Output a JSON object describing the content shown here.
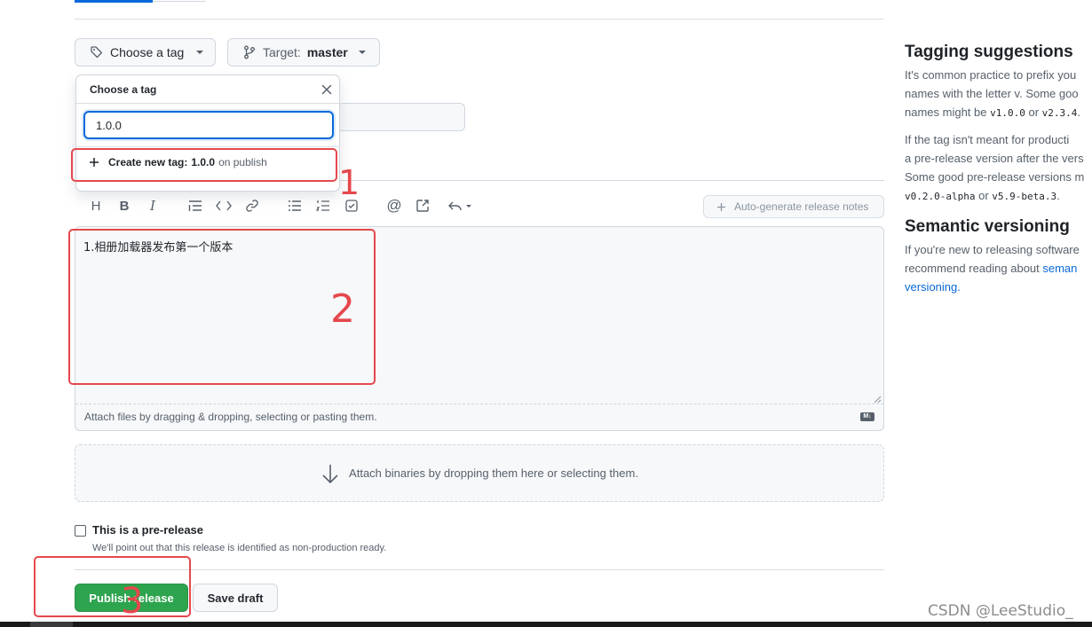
{
  "tag_button": {
    "label": "Choose a tag"
  },
  "target_button": {
    "prefix": "Target:",
    "branch": "master"
  },
  "tag_dropdown": {
    "title": "Choose a tag",
    "input_value": "1.0.0",
    "create_prefix": "Create new tag:",
    "create_tag": "1.0.0",
    "create_suffix": "on publish"
  },
  "toolbar": {
    "auto_notes_label": "Auto-generate release notes"
  },
  "editor": {
    "body": "1.相册加载器发布第一个版本",
    "attach_hint": "Attach files by dragging & dropping, selecting or pasting them.",
    "markdown_badge": "M↓"
  },
  "binaries": {
    "label": "Attach binaries by dropping them here or selecting them."
  },
  "prerelease": {
    "label": "This is a pre-release",
    "hint": "We'll point out that this release is identified as non-production ready.",
    "checked": false
  },
  "actions": {
    "publish_label": "Publish release",
    "draft_label": "Save draft"
  },
  "annotations": {
    "one": "1",
    "two": "2",
    "three": "3"
  },
  "sidebar": {
    "tagging_title": "Tagging suggestions",
    "tagging_p1_line1": "It's common practice to prefix you",
    "tagging_p1_line2": "names with the letter v. Some goo",
    "tagging_p1_line3_pre": "names might be ",
    "tagging_p1_code1": "v1.0.0",
    "tagging_p1_mid": " or ",
    "tagging_p1_code2": "v2.3.4",
    "tagging_p1_end": ".",
    "tagging_p2_line1": "If the tag isn't meant for producti",
    "tagging_p2_line2": "a pre-release version after the vers",
    "tagging_p2_line3": "Some good pre-release versions m",
    "tagging_p2_code1": "v0.2.0-alpha",
    "tagging_p2_mid": " or ",
    "tagging_p2_code2": "v5.9-beta.3",
    "tagging_p2_end": ".",
    "semver_title": "Semantic versioning",
    "semver_line1": "If you're new to releasing software",
    "semver_line2_pre": "recommend reading about ",
    "semver_link1": "seman",
    "semver_link2": "versioning."
  },
  "watermark": "CSDN @LeeStudio_",
  "colors": {
    "accent_green": "#2da44e",
    "annotation_red": "#e5484d",
    "link_blue": "#0969da"
  }
}
